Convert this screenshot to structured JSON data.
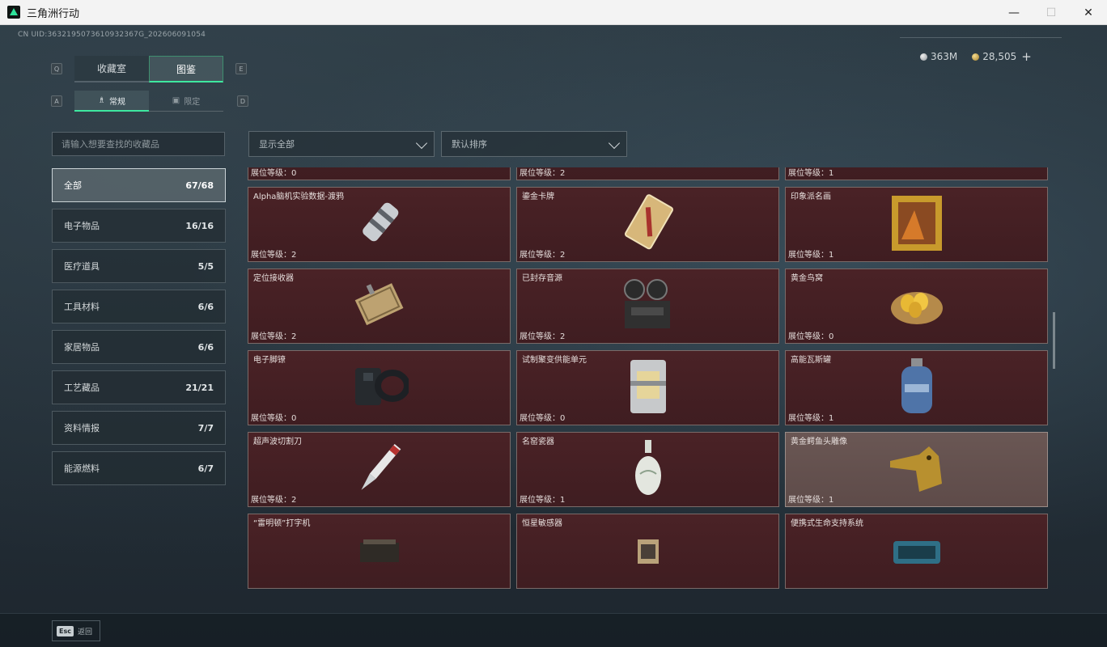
{
  "window": {
    "title": "三角洲行动",
    "minimize": "—",
    "maximize": "☐",
    "close": "✕"
  },
  "uid": "CN UID:3632195073610932367G_202606091054",
  "currency": {
    "silver": "363M",
    "gold": "28,505",
    "add": "+"
  },
  "keys": {
    "prev_tab": "Q",
    "next_tab": "E",
    "prev_sub": "A",
    "next_sub": "D"
  },
  "tabs": [
    {
      "label": "收藏室"
    },
    {
      "label": "图鉴",
      "active": true
    }
  ],
  "subtabs": [
    {
      "label": "常规",
      "active": true
    },
    {
      "label": "限定"
    }
  ],
  "search": {
    "placeholder": "请输入想要查找的收藏品"
  },
  "filters": {
    "show": "显示全部",
    "sort": "默认排序"
  },
  "categories": [
    {
      "label": "全部",
      "count": "67/68",
      "active": true
    },
    {
      "label": "电子物品",
      "count": "16/16"
    },
    {
      "label": "医疗道具",
      "count": "5/5"
    },
    {
      "label": "工具材料",
      "count": "6/6"
    },
    {
      "label": "家居物品",
      "count": "6/6"
    },
    {
      "label": "工艺藏品",
      "count": "21/21"
    },
    {
      "label": "资料情报",
      "count": "7/7"
    },
    {
      "label": "能源燃料",
      "count": "6/7"
    }
  ],
  "items": [
    {
      "name": "",
      "level": "展位等级：0",
      "icon": "caviar-tin-icon"
    },
    {
      "name": "",
      "level": "展位等级：2",
      "icon": "device-icon"
    },
    {
      "name": "",
      "level": "展位等级：1",
      "icon": "map-blueprint-icon"
    },
    {
      "name": "Alpha脑机实验数据-渡鸦",
      "level": "展位等级：2",
      "icon": "data-canister-icon"
    },
    {
      "name": "鎏金卡牌",
      "level": "展位等级：2",
      "icon": "gilded-card-icon"
    },
    {
      "name": "印象派名画",
      "level": "展位等级：1",
      "icon": "painting-icon"
    },
    {
      "name": "定位接收器",
      "level": "展位等级：2",
      "icon": "receiver-icon"
    },
    {
      "name": "已封存音源",
      "level": "展位等级：2",
      "icon": "reel-recorder-icon"
    },
    {
      "name": "黄金鸟窝",
      "level": "展位等级：0",
      "icon": "golden-nest-icon"
    },
    {
      "name": "电子脚镣",
      "level": "展位等级：0",
      "icon": "ankle-monitor-icon"
    },
    {
      "name": "试制聚变供能单元",
      "level": "展位等级：0",
      "icon": "fusion-cell-icon"
    },
    {
      "name": "高能瓦斯罐",
      "level": "展位等级：1",
      "icon": "gas-tank-icon"
    },
    {
      "name": "超声波切割刀",
      "level": "展位等级：2",
      "icon": "cutter-knife-icon"
    },
    {
      "name": "名窑瓷器",
      "level": "展位等级：1",
      "icon": "porcelain-vase-icon"
    },
    {
      "name": "黄金鳄鱼头雕像",
      "level": "展位等级：1",
      "icon": "crocodile-statue-icon",
      "hover": true
    },
    {
      "name": "“雷明顿”打字机",
      "level": "",
      "icon": "typewriter-icon"
    },
    {
      "name": "恒星敏感器",
      "level": "",
      "icon": "star-sensor-icon"
    },
    {
      "name": "便携式生命支持系统",
      "level": "",
      "icon": "life-support-icon"
    }
  ],
  "footer": {
    "key": "Esc",
    "label": "返回"
  }
}
